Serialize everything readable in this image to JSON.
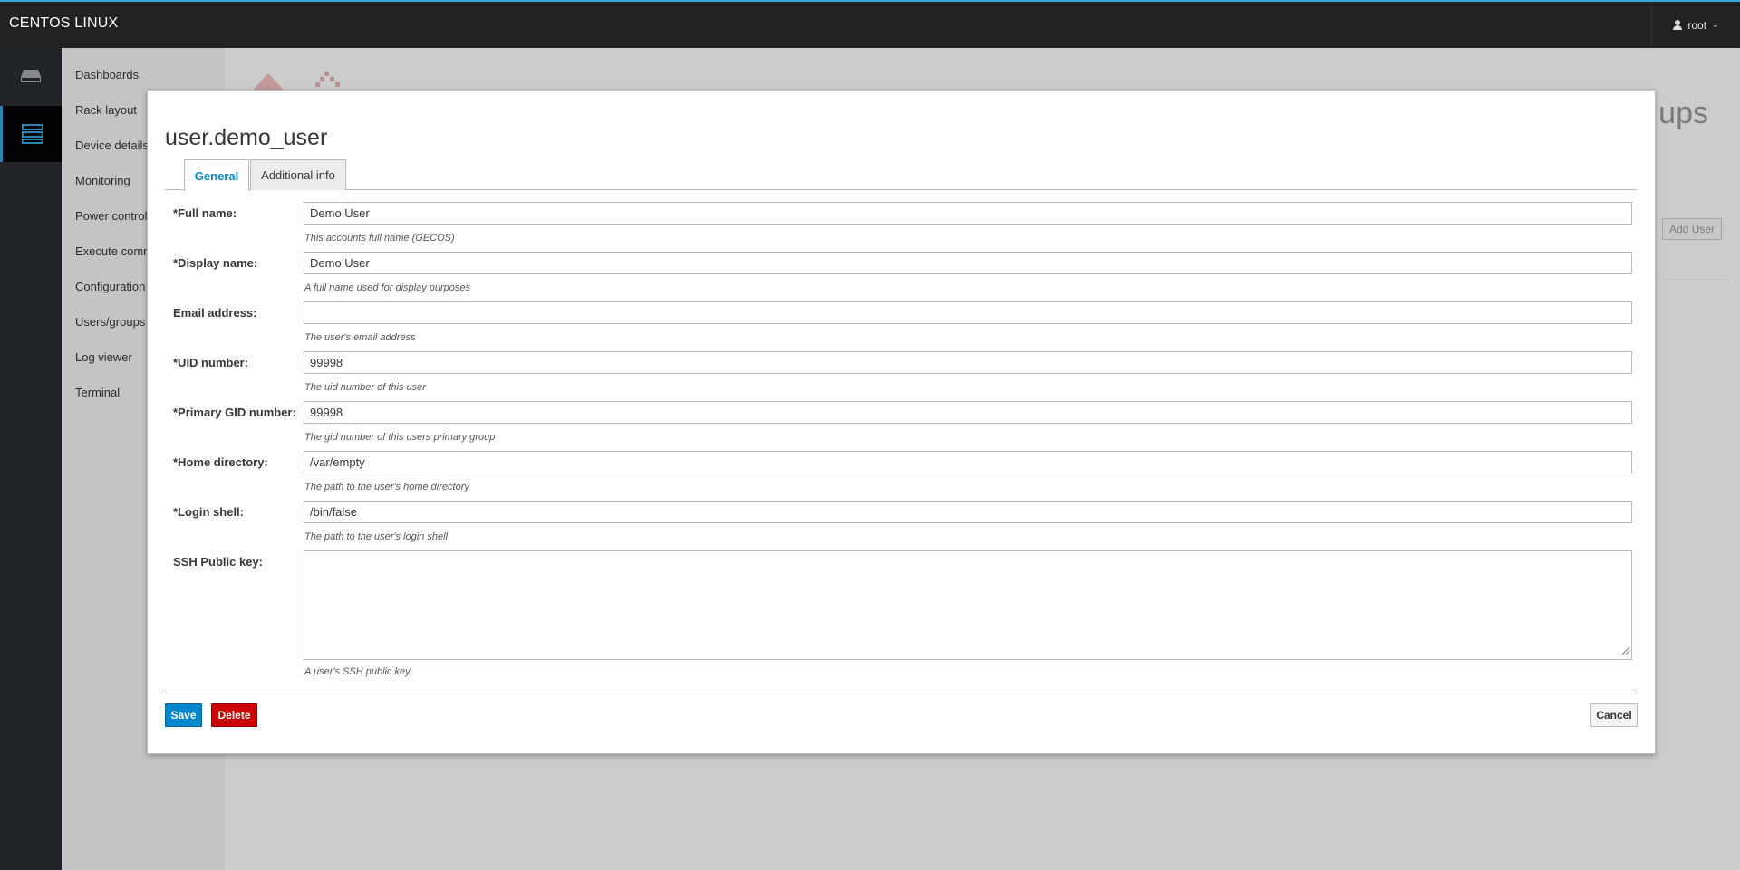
{
  "topbar": {
    "brand": "CENTOS LINUX",
    "user": "root",
    "user_icon": "user-icon",
    "chevron": "⌄"
  },
  "rail": {
    "items": [
      {
        "icon": "drive-icon"
      },
      {
        "icon": "server-list-icon",
        "active": true
      }
    ]
  },
  "menu": {
    "items": [
      {
        "label": "Dashboards"
      },
      {
        "label": "Rack layout"
      },
      {
        "label": "Device details"
      },
      {
        "label": "Monitoring"
      },
      {
        "label": "Power control"
      },
      {
        "label": "Execute comm"
      },
      {
        "label": "Configuration"
      },
      {
        "label": "Users/groups"
      },
      {
        "label": "Log viewer"
      },
      {
        "label": "Terminal"
      }
    ]
  },
  "background": {
    "title": "ups",
    "add_user": "Add User"
  },
  "modal": {
    "title": "user.demo_user",
    "tabs": [
      {
        "label": "General",
        "active": true
      },
      {
        "label": "Additional info",
        "active": false
      }
    ],
    "fields": [
      {
        "label": "*Full name:",
        "value": "Demo User",
        "help": "This accounts full name (GECOS)"
      },
      {
        "label": "*Display name:",
        "value": "Demo User",
        "help": "A full name used for display purposes"
      },
      {
        "label": "Email address:",
        "value": "",
        "help": "The user's email address"
      },
      {
        "label": "*UID number:",
        "value": "99998",
        "help": "The uid number of this user"
      },
      {
        "label": "*Primary GID number:",
        "value": "99998",
        "help": "The gid number of this users primary group"
      },
      {
        "label": "*Home directory:",
        "value": "/var/empty",
        "help": "The path to the user's home directory"
      },
      {
        "label": "*Login shell:",
        "value": "/bin/false",
        "help": "The path to the user's login shell"
      },
      {
        "label": "SSH Public key:",
        "value": "",
        "help": "A user's SSH public key"
      }
    ],
    "buttons": {
      "save": "Save",
      "delete": "Delete",
      "cancel": "Cancel"
    }
  },
  "colors": {
    "accent": "#0088ce",
    "danger": "#cc0000",
    "topbar": "#222222",
    "rail": "#292e34"
  }
}
